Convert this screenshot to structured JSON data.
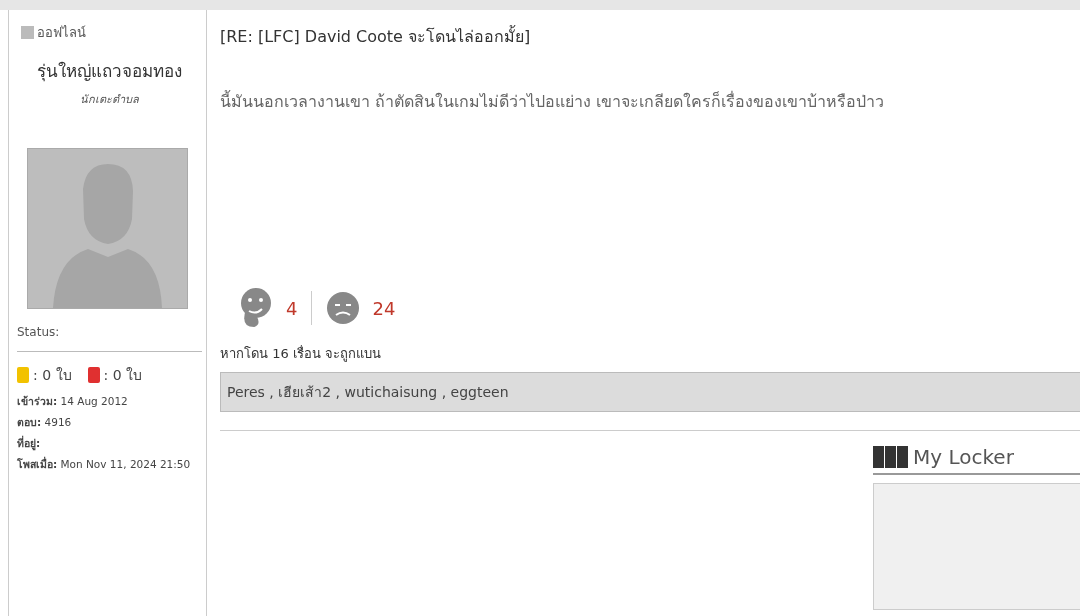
{
  "author": {
    "online": false,
    "status_label": "ออฟไลน์",
    "username": "รุ่นใหญ่แถวจอมทอง",
    "rank": "นักเตะตำบล",
    "status_text": "Status:",
    "cards": [
      {
        "color": "#f2c200",
        "count": ": 0 ใบ"
      },
      {
        "color": "#e03030",
        "count": ": 0 ใบ"
      }
    ],
    "info": [
      "**เข้าร่วม:** 14 Aug 2012",
      "**ตอบ:** 4916",
      "**ที่อยู่:**",
      "**โพสเมื่อ:** Mon Nov 11, 2024 21:50"
    ]
  },
  "post": {
    "title": "[RE: [LFC] David Coote จะโดนไล่ออกมั้ย]",
    "body": "นี้มันนอกเวลางานเขา ถ้าตัดสินในเกมไม่ดีว่าไปอแย่าง เขาจะเกลียดใครก็เรื่องของเขาบ้าหรือป่าว",
    "reactions": [
      {
        "kind": "laugh",
        "count": "4"
      },
      {
        "kind": "meh",
        "count": "24"
      }
    ],
    "ban_note": "หากโดน 16 เรื่อน จะถูกแบน",
    "voters": "Peres , เฮียเส้า2 , wutichaisung , eggteen"
  },
  "locker": {
    "title": "My Locker"
  }
}
